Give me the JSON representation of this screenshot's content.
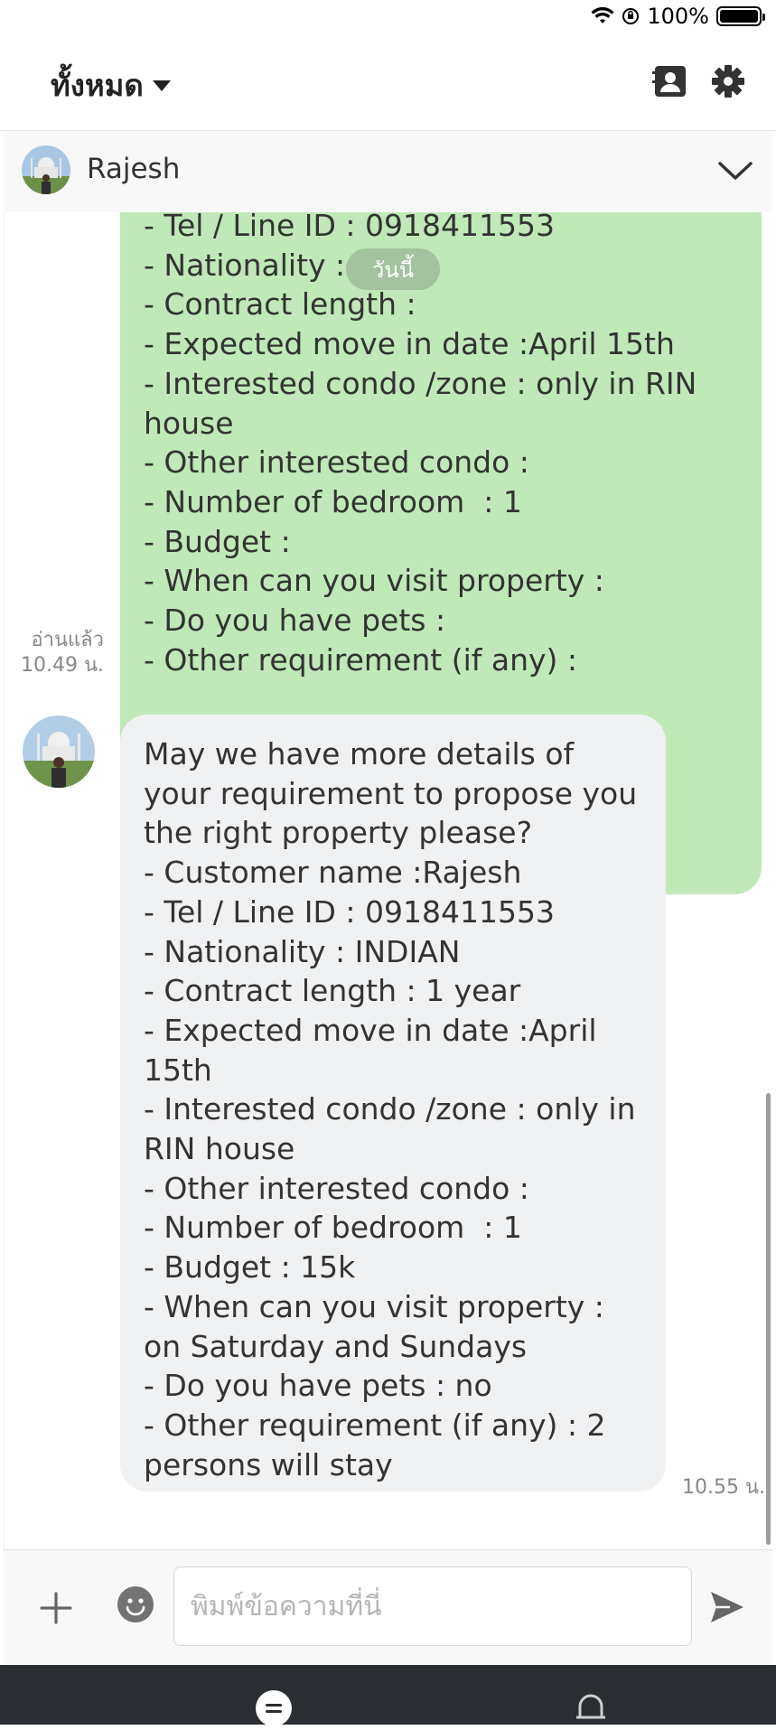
{
  "status_bar": {
    "battery_text": "100%",
    "battery_level": 1.0
  },
  "header": {
    "filter_label": "ทั้งหมด",
    "icons": [
      "contacts-icon",
      "gear-icon"
    ]
  },
  "chat": {
    "contact_name": "Rajesh"
  },
  "date_chip": "วันนี้",
  "messages": [
    {
      "direction": "sent",
      "text": "- Tel / Line ID : 0918411553\n- Nationality :\n- Contract length :\n- Expected move in date :April 15th\n- Interested condo /zone : only in RIN house\n- Other interested condo :\n- Number of bedroom  : 1\n- Budget :\n- When can you visit property :\n- Do you have pets :\n- Other requirement (if any) :",
      "read_label": "อ่านแล้ว",
      "time": "10.49 น."
    },
    {
      "direction": "received",
      "text": "May we have more details of your requirement to propose you the right property please?\n- Customer name :Rajesh\n- Tel / Line ID : 0918411553\n- Nationality : INDIAN\n- Contract length : 1 year\n- Expected move in date :April 15th\n- Interested condo /zone : only in RIN house\n- Other interested condo :\n- Number of bedroom  : 1\n- Budget : 15k\n- When can you visit property : on Saturday and Sundays\n- Do you have pets : no\n- Other requirement (if any) : 2 persons will stay",
      "time": "10.55 น."
    }
  ],
  "input": {
    "placeholder": "พิมพ์ข้อความที่นี่",
    "value": ""
  },
  "colors": {
    "sent_bubble": "#c0e8b8",
    "received_bubble": "#f0f1f2",
    "nav_bg": "#2a2d31"
  }
}
